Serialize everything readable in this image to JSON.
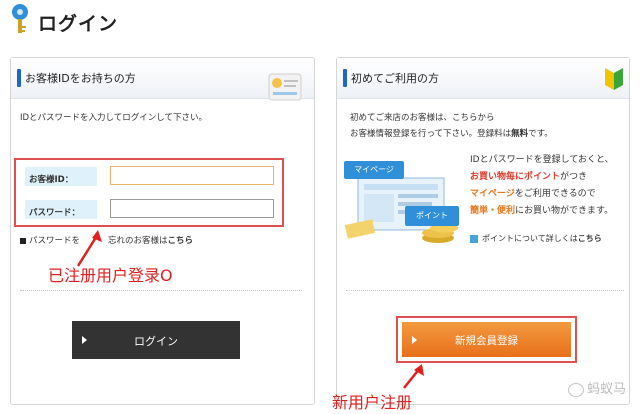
{
  "header": {
    "title": "ログイン"
  },
  "left_panel": {
    "title": "お客様IDをお持ちの方",
    "instruction": "IDとパスワードを入力してログインして下さい。",
    "fields": [
      {
        "label": "お客様ID：",
        "value": ""
      },
      {
        "label": "パスワード：",
        "value": ""
      }
    ],
    "forgot_prefix": "パスワードを",
    "forgot_suffix": "忘れのお客様は",
    "forgot_link": "こちら",
    "annotation": "已注册用户登录O",
    "login_button": "ログイン"
  },
  "right_panel": {
    "title": "初めてご利用の方",
    "intro_line1": "初めてご来店のお客様は、こちらから",
    "intro_line2a": "お客様情報登録を行って下さい。登録料は",
    "intro_line2b": "無料",
    "intro_line2c": "です。",
    "promo": {
      "l1": "IDとパスワードを登録しておくと、",
      "l2a": "お買い物毎に",
      "l2b": "ポイント",
      "l2c": "がつき",
      "l3a": "マイページ",
      "l3b": "をご利用できるので",
      "l4a": "簡単・便利",
      "l4b": "にお買い物ができます。"
    },
    "illustration": {
      "tag1": "マイページ",
      "tag2": "ポイント"
    },
    "points_link_prefix": "ポイントについて詳しくは",
    "points_link": "こちら",
    "register_button": "新規会員登録",
    "annotation": "新用户注册"
  },
  "watermark": "蚂蚁马",
  "colors": {
    "accent_blue": "#1f66c8",
    "annotation_red": "#e02020",
    "register_orange": "#e8701b",
    "login_dark": "#333333"
  }
}
